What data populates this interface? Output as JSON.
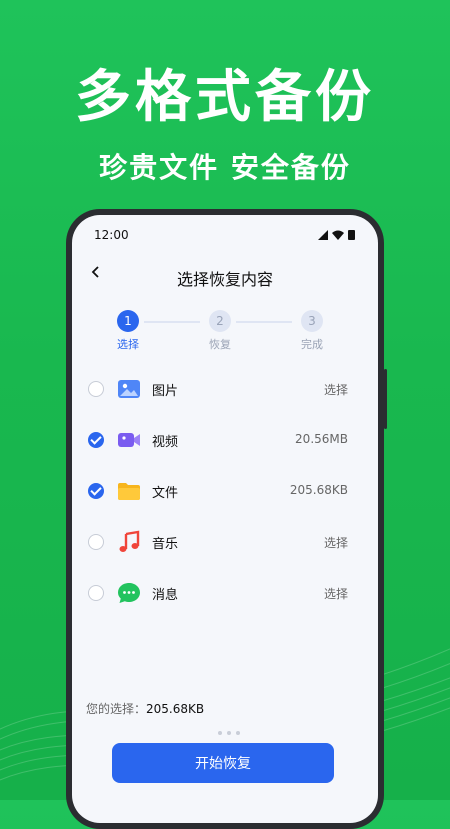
{
  "hero": {
    "title": "多格式备份",
    "subtitle": "珍贵文件 安全备份"
  },
  "phone": {
    "status_time": "12:00",
    "nav": {
      "back_icon": "chevron-left-icon",
      "title": "选择恢复内容"
    },
    "steps": [
      {
        "num": "1",
        "label": "选择",
        "state": "active"
      },
      {
        "num": "2",
        "label": "恢复",
        "state": "inactive"
      },
      {
        "num": "3",
        "label": "完成",
        "state": "inactive"
      }
    ],
    "items": [
      {
        "label": "图片",
        "right": "选择",
        "checked": false,
        "icon": "image-icon"
      },
      {
        "label": "视频",
        "right": "20.56MB",
        "checked": true,
        "icon": "video-icon"
      },
      {
        "label": "文件",
        "right": "205.68KB",
        "checked": true,
        "icon": "folder-icon"
      },
      {
        "label": "音乐",
        "right": "选择",
        "checked": false,
        "icon": "music-note-icon"
      },
      {
        "label": "消息",
        "right": "选择",
        "checked": false,
        "icon": "chat-bubble-icon"
      }
    ],
    "selection": {
      "label": "您的选择：",
      "value": "205.68KB"
    },
    "start_button": "开始恢复"
  },
  "colors": {
    "background_green": "#1fc35a",
    "accent_blue": "#2a66ee",
    "phone_frame": "#2b2d31"
  }
}
